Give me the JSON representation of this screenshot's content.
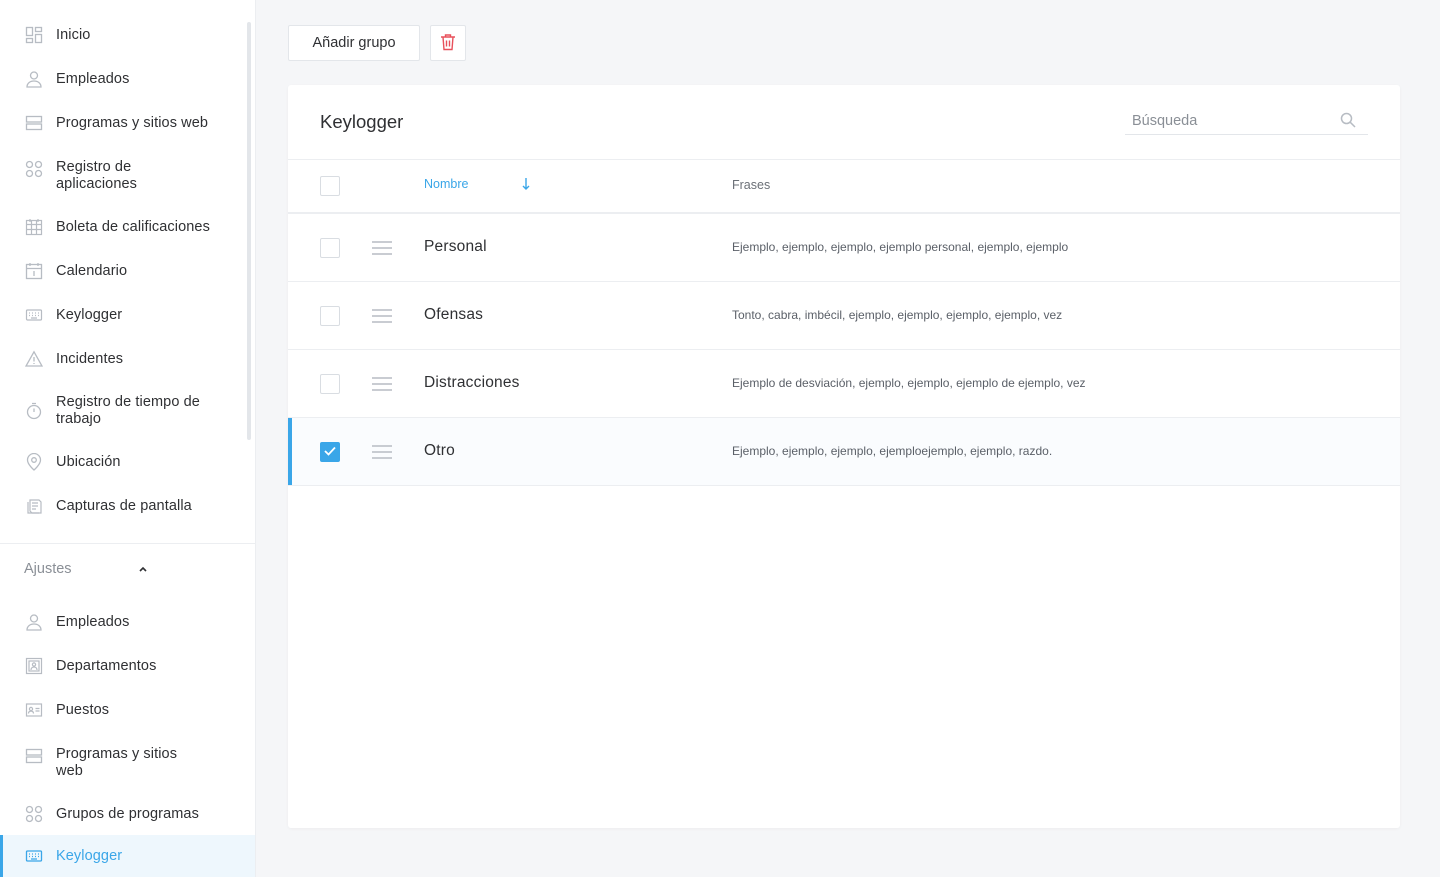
{
  "sidebar": {
    "items": [
      {
        "label": "Inicio",
        "icon": "dashboard-icon"
      },
      {
        "label": "Empleados",
        "icon": "user-icon"
      },
      {
        "label": "Programas y sitios web",
        "icon": "server-icon"
      },
      {
        "label": "Registro de aplicaciones",
        "icon": "apps-grid-icon"
      },
      {
        "label": "Boleta de calificaciones",
        "icon": "calendar-grid-icon"
      },
      {
        "label": "Calendario",
        "icon": "calendar-icon"
      },
      {
        "label": "Keylogger",
        "icon": "keyboard-icon"
      },
      {
        "label": "Incidentes",
        "icon": "warning-icon"
      },
      {
        "label": "Registro de tiempo de trabajo",
        "icon": "stopwatch-icon"
      },
      {
        "label": "Ubicación",
        "icon": "location-pin-icon"
      },
      {
        "label": "Capturas de pantalla",
        "icon": "screenshots-icon"
      }
    ],
    "settings_section": "Ajustes",
    "settings_items": [
      {
        "label": "Empleados",
        "icon": "user-icon"
      },
      {
        "label": "Departamentos",
        "icon": "department-icon"
      },
      {
        "label": "Puestos",
        "icon": "id-card-icon"
      },
      {
        "label": "Programas y sitios web",
        "icon": "server-icon"
      },
      {
        "label": "Grupos de programas",
        "icon": "apps-grid-icon"
      },
      {
        "label": "Keylogger",
        "icon": "keyboard-icon",
        "active": true
      }
    ]
  },
  "toolbar": {
    "add_group_label": "Añadir grupo"
  },
  "card": {
    "title": "Keylogger",
    "search_placeholder": "Búsqueda",
    "columns": {
      "name": "Nombre",
      "sort_arrow": "↓",
      "phrases": "Frases"
    },
    "rows": [
      {
        "name": "Personal",
        "phrases": "Ejemplo, ejemplo, ejemplo, ejemplo personal, ejemplo, ejemplo",
        "checked": false
      },
      {
        "name": "Ofensas",
        "phrases": "Tonto, cabra, imbécil, ejemplo, ejemplo, ejemplo, ejemplo, vez",
        "checked": false
      },
      {
        "name": "Distracciones",
        "phrases": "Ejemplo de desviación, ejemplo, ejemplo, ejemplo de ejemplo, vez",
        "checked": false
      },
      {
        "name": "Otro",
        "phrases": "Ejemplo, ejemplo, ejemplo, ejemploejemplo, ejemplo, razdo.",
        "checked": true
      }
    ]
  },
  "colors": {
    "accent": "#3aa6e8",
    "delete": "#e8505b",
    "icon_gray": "#b7bcc3"
  }
}
